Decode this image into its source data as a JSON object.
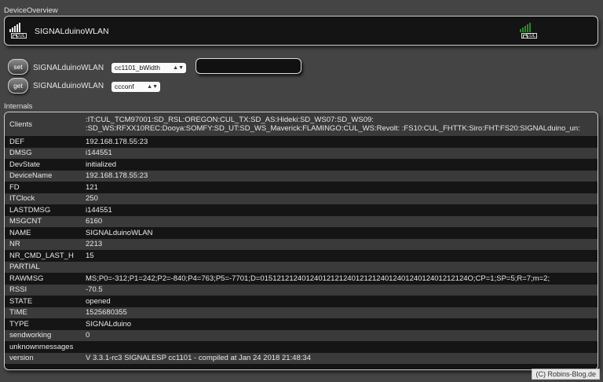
{
  "overview": {
    "title": "DeviceOverview",
    "device_name": "SIGNALduinoWLAN",
    "icon_label": "CUL",
    "status_color": "#1e8f1e"
  },
  "commands": {
    "set": {
      "button": "set",
      "device": "SIGNALduinoWLAN",
      "selected": "cc1101_bWidth",
      "input_value": ""
    },
    "get": {
      "button": "get",
      "device": "SIGNALduinoWLAN",
      "selected": "ccconf"
    }
  },
  "internals": {
    "title": "Internals",
    "rows": [
      {
        "key": "Clients",
        "value": ":IT:CUL_TCM97001:SD_RSL:OREGON:CUL_TX:SD_AS:Hideki:SD_WS07:SD_WS09:",
        "value2": ":SD_WS:RFXX10REC:Dooya:SOMFY:SD_UT:SD_WS_Maverick:FLAMINGO:CUL_WS:Revolt: :FS10:CUL_FHTTK:Siro:FHT:FS20:SIGNALduino_un:"
      },
      {
        "key": "DEF",
        "value": "192.168.178.55:23"
      },
      {
        "key": "DMSG",
        "value": "i144551"
      },
      {
        "key": "DevState",
        "value": "initialized"
      },
      {
        "key": "DeviceName",
        "value": "192.168.178.55:23"
      },
      {
        "key": "FD",
        "value": "121"
      },
      {
        "key": "ITClock",
        "value": "250"
      },
      {
        "key": "LASTDMSG",
        "value": "i144551"
      },
      {
        "key": "MSGCNT",
        "value": "6160"
      },
      {
        "key": "NAME",
        "value": "SIGNALduinoWLAN"
      },
      {
        "key": "NR",
        "value": "2213"
      },
      {
        "key": "NR_CMD_LAST_H",
        "value": "15"
      },
      {
        "key": "PARTIAL",
        "value": ""
      },
      {
        "key": "RAWMSG",
        "value": "MS;P0=-312;P1=242;P2=-840;P4=763;P5=-7701;D=01512121240124012121240121212401240124012401212124O;CP=1;SP=5;R=7;m=2;"
      },
      {
        "key": "RSSI",
        "value": "-70.5"
      },
      {
        "key": "STATE",
        "value": "opened"
      },
      {
        "key": "TIME",
        "value": "1525680355"
      },
      {
        "key": "TYPE",
        "value": "SIGNALduino"
      },
      {
        "key": "sendworking",
        "value": "0"
      },
      {
        "key": "unknownmessages",
        "value": ""
      },
      {
        "key": "version",
        "value": "V 3.3.1-rc3 SIGNALESP cc1101 - compiled at Jan 24 2018 21:48:34"
      }
    ]
  },
  "watermark": "(C) Robins-Blog.de"
}
